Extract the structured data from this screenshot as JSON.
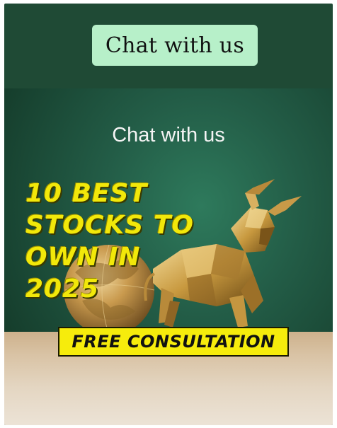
{
  "header": {
    "chat_button_label": "Chat with us"
  },
  "banner": {
    "chat_label": "Chat with us",
    "headline_lines": [
      "10 BEST",
      "STOCKS TO",
      "OWN IN",
      "2025"
    ],
    "cta_label": "FREE CONSULTATION",
    "icons": [
      "globe-icon",
      "bull-icon"
    ]
  },
  "colors": {
    "header_bg": "#1f4a35",
    "chat_button_bg": "#b7f0c9",
    "headline": "#f2e80a",
    "cta_bg": "#f6ec0c"
  }
}
